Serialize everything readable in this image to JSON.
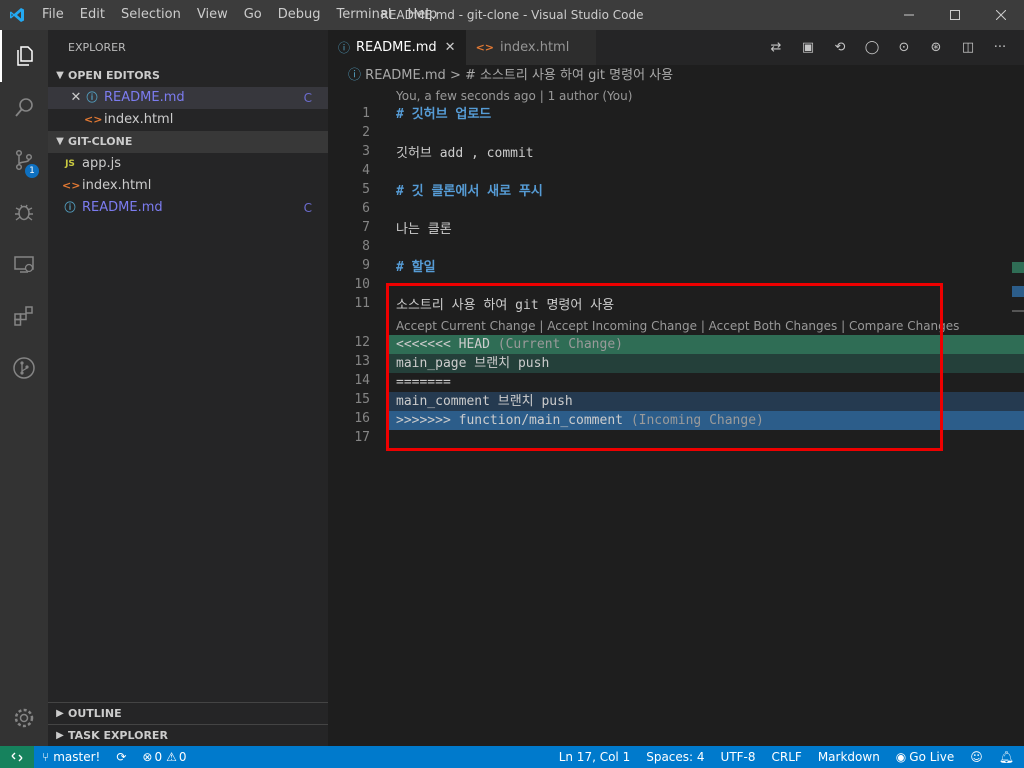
{
  "window": {
    "title": "README.md - git-clone - Visual Studio Code"
  },
  "menu": [
    "File",
    "Edit",
    "Selection",
    "View",
    "Go",
    "Debug",
    "Terminal",
    "Help"
  ],
  "activity": {
    "scm_badge": "1"
  },
  "sidebar": {
    "title": "EXPLORER",
    "open_editors": {
      "label": "OPEN EDITORS",
      "items": [
        {
          "name": "README.md",
          "status": "C"
        },
        {
          "name": "index.html",
          "status": ""
        }
      ]
    },
    "folder": {
      "label": "GIT-CLONE",
      "items": [
        {
          "name": "app.js",
          "status": ""
        },
        {
          "name": "index.html",
          "status": ""
        },
        {
          "name": "README.md",
          "status": "C"
        }
      ]
    },
    "outline": "OUTLINE",
    "task_explorer": "TASK EXPLORER"
  },
  "tabs": [
    {
      "label": "README.md",
      "active": true
    },
    {
      "label": "index.html",
      "active": false
    }
  ],
  "breadcrumb": {
    "file": "README.md",
    "symbol": "# 소스트리 사용 하여 git 명령어 사용"
  },
  "blame": "You, a few seconds ago | 1 author (You)",
  "codelens": "Accept Current Change | Accept Incoming Change | Accept Both Changes | Compare Changes",
  "lines": [
    {
      "n": "1",
      "text": "# 깃허브 업로드"
    },
    {
      "n": "2",
      "text": ""
    },
    {
      "n": "3",
      "text": "깃허브 add , commit"
    },
    {
      "n": "4",
      "text": ""
    },
    {
      "n": "5",
      "text": "# 깃 클론에서 새로 푸시"
    },
    {
      "n": "6",
      "text": ""
    },
    {
      "n": "7",
      "text": "나는 클론"
    },
    {
      "n": "8",
      "text": ""
    },
    {
      "n": "9",
      "text": "# 할일"
    },
    {
      "n": "10",
      "text": ""
    },
    {
      "n": "11",
      "text": "소스트리 사용 하여 git 명령어 사용"
    },
    {
      "n": "12",
      "text": "<<<<<<< HEAD",
      "note": "(Current Change)"
    },
    {
      "n": "13",
      "text": "main_page 브랜치 push"
    },
    {
      "n": "14",
      "text": "======="
    },
    {
      "n": "15",
      "text": "main_comment 브랜치 push"
    },
    {
      "n": "16",
      "text": ">>>>>>> function/main_comment",
      "note": "(Incoming Change)"
    },
    {
      "n": "17",
      "text": ""
    }
  ],
  "status": {
    "branch": "master!",
    "errors": "0",
    "warnings": "0",
    "position": "Ln 17, Col 1",
    "spaces": "Spaces: 4",
    "encoding": "UTF-8",
    "eol": "CRLF",
    "language": "Markdown",
    "golive": "Go Live"
  },
  "colors": {
    "accent": "#007acc",
    "current_header": "#2f6d55",
    "current_body": "#24403a",
    "incoming_header": "#2c5d8a",
    "incoming_body": "#253a50",
    "highlight_box": "#e00000"
  }
}
